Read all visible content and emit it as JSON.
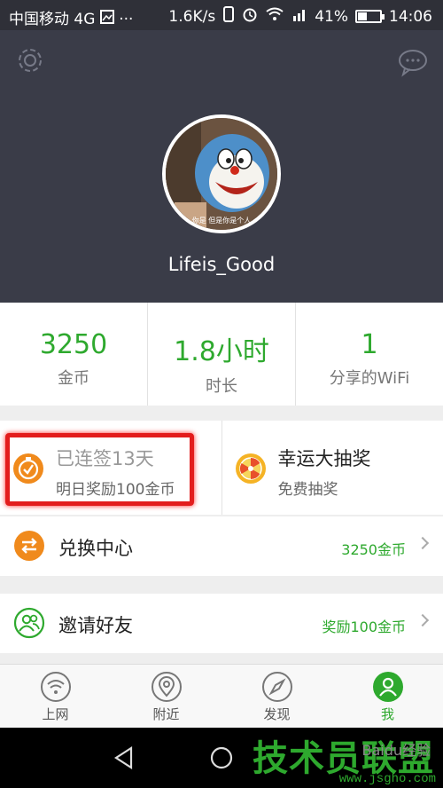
{
  "status_bar": {
    "carrier": "中国移动 4G",
    "speed": "1.6K/s",
    "battery_percent": "41%",
    "time": "14:06",
    "battery_level": 0.41
  },
  "profile": {
    "username": "Lifeis_Good",
    "avatar_caption": "你是 但是你是个人"
  },
  "stats": [
    {
      "value": "3250",
      "label": "金币"
    },
    {
      "value": "1.8小时",
      "label": "时长"
    },
    {
      "value": "1",
      "label": "分享的WiFi"
    }
  ],
  "checkin": {
    "title": "已连签13天",
    "subtitle": "明日奖励100金币"
  },
  "lottery": {
    "title": "幸运大抽奖",
    "subtitle": "免费抽奖"
  },
  "rows": [
    {
      "title": "兑换中心",
      "value": "3250金币"
    },
    {
      "title": "邀请好友",
      "value": "奖励100金币"
    }
  ],
  "tabs": [
    {
      "label": "上网",
      "icon": "wifi-icon"
    },
    {
      "label": "附近",
      "icon": "location-icon"
    },
    {
      "label": "发现",
      "icon": "compass-icon"
    },
    {
      "label": "我",
      "icon": "person-icon"
    }
  ],
  "watermark": {
    "brand": "技术员联盟",
    "url": "www.jsgho.com",
    "exp": "Baidu经验"
  },
  "colors": {
    "accent": "#2ea92e",
    "header": "#3a3c48",
    "highlight": "#e31d1d",
    "orange": "#f08a1c"
  }
}
